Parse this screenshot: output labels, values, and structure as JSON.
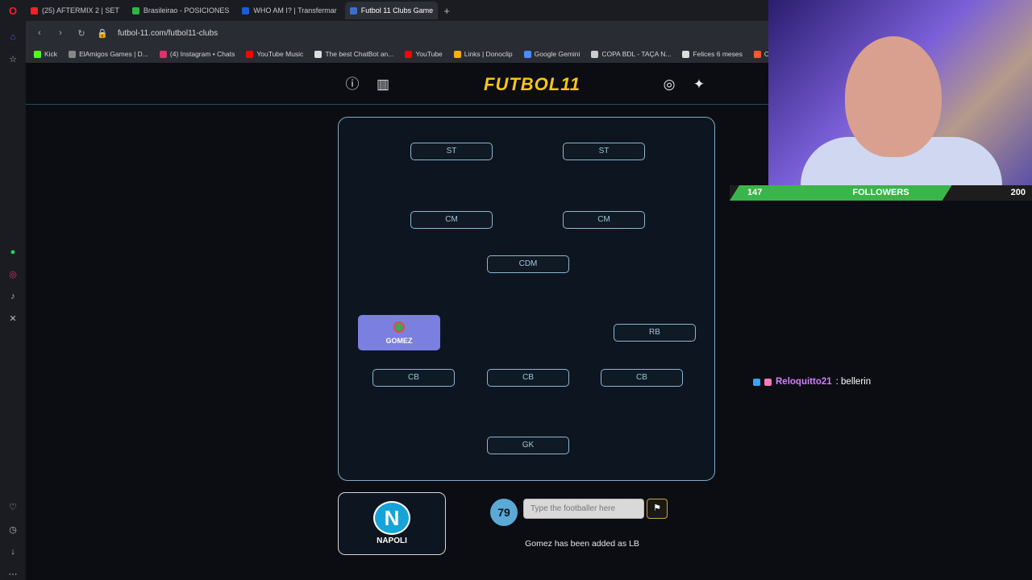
{
  "browser": {
    "tabs": [
      {
        "label": "(25) AFTERMIX 2 | SET",
        "color": "#ff2020"
      },
      {
        "label": "Brasileirao - POSICIONES",
        "color": "#2fb34a"
      },
      {
        "label": "WHO AM I? | Transfermar",
        "color": "#1e5bd8"
      },
      {
        "label": "Futbol 11 Clubs Game",
        "color": "#3a70c8",
        "active": true
      }
    ],
    "url": "futbol-11.com/futbol11-clubs",
    "bookmarks": [
      {
        "label": "Kick",
        "color": "#53fc18"
      },
      {
        "label": "ElAmigos Games | D...",
        "color": "#888888"
      },
      {
        "label": "(4) Instagram • Chats",
        "color": "#e1306c"
      },
      {
        "label": "YouTube Music",
        "color": "#ff0000"
      },
      {
        "label": "The best ChatBot an...",
        "color": "#dddddd"
      },
      {
        "label": "YouTube",
        "color": "#ff0000"
      },
      {
        "label": "Links | Donoclip",
        "color": "#f5b000"
      },
      {
        "label": "Google Gemini",
        "color": "#4a8cff"
      },
      {
        "label": "COPA BDL - TAÇA N...",
        "color": "#cccccc"
      },
      {
        "label": "Felices 6 meses",
        "color": "#dddddd"
      },
      {
        "label": "Credits - AxentHost",
        "color": "#ff5533"
      }
    ]
  },
  "site": {
    "logo": "FUTBOL11",
    "icons": [
      "info-icon",
      "stats-icon",
      "instagram-icon",
      "twitter-icon"
    ]
  },
  "pitch": {
    "slots": {
      "st1": "ST",
      "st2": "ST",
      "cm1": "CM",
      "cm2": "CM",
      "cdm": "CDM",
      "rb": "RB",
      "cb1": "CB",
      "cb2": "CB",
      "cb3": "CB",
      "gk": "GK"
    },
    "placed_player": "GOMEZ"
  },
  "club": {
    "name": "NAPOLI",
    "crest_letter": "N"
  },
  "game": {
    "score": "79",
    "input_placeholder": "Type the footballer here",
    "status": "Gomez has been added as LB"
  },
  "stream": {
    "followers_current": "147",
    "followers_label": "FOLLOWERS",
    "followers_goal": "200",
    "followers_progress": 0.735,
    "chat": {
      "user": "Reloquitto21",
      "message": ": bellerin"
    }
  }
}
